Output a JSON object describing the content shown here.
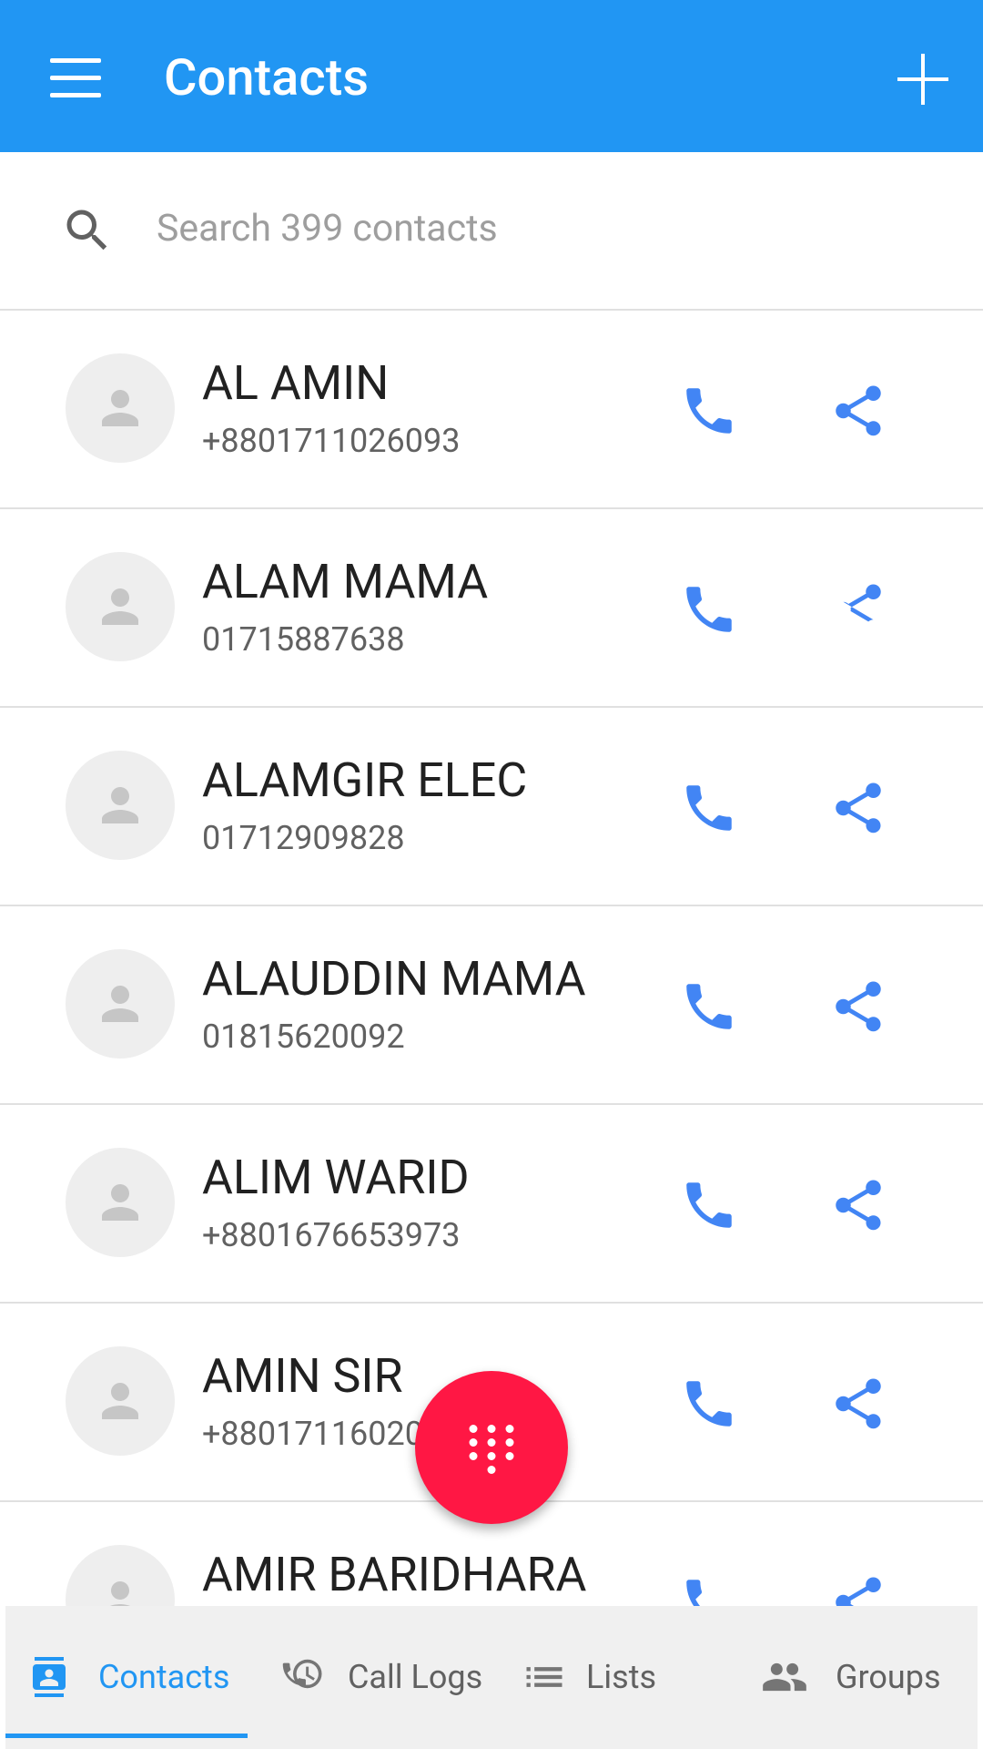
{
  "app_bar": {
    "title": "Contacts",
    "menu_icon": "menu-icon",
    "add_icon": "plus-icon",
    "color": "#2196F3"
  },
  "search": {
    "placeholder": "Search 399 contacts",
    "value": ""
  },
  "contacts": [
    {
      "name": "AL AMIN",
      "phone": "+8801711026093"
    },
    {
      "name": "ALAM MAMA",
      "phone": "01715887638"
    },
    {
      "name": "ALAMGIR ELEC",
      "phone": "01712909828"
    },
    {
      "name": "ALAUDDIN MAMA",
      "phone": "01815620092"
    },
    {
      "name": "ALIM WARID",
      "phone": "+8801676653973"
    },
    {
      "name": "AMIN SIR",
      "phone": "+880171160201"
    },
    {
      "name": "AMIR BARIDHARA",
      "phone": ""
    }
  ],
  "fab": {
    "icon": "dialpad-icon",
    "color": "#FF1744"
  },
  "bottom_nav": {
    "items": [
      {
        "label": "Contacts",
        "icon": "contacts-icon",
        "active": true
      },
      {
        "label": "Call Logs",
        "icon": "call-log-icon",
        "active": false
      },
      {
        "label": "Lists",
        "icon": "list-icon",
        "active": false
      },
      {
        "label": "Groups",
        "icon": "groups-icon",
        "active": false
      }
    ]
  },
  "colors": {
    "accent": "#2196F3",
    "action_icon": "#4285F4",
    "avatar_bg": "#eeeeee",
    "avatar_fg": "#c6c6c6"
  }
}
